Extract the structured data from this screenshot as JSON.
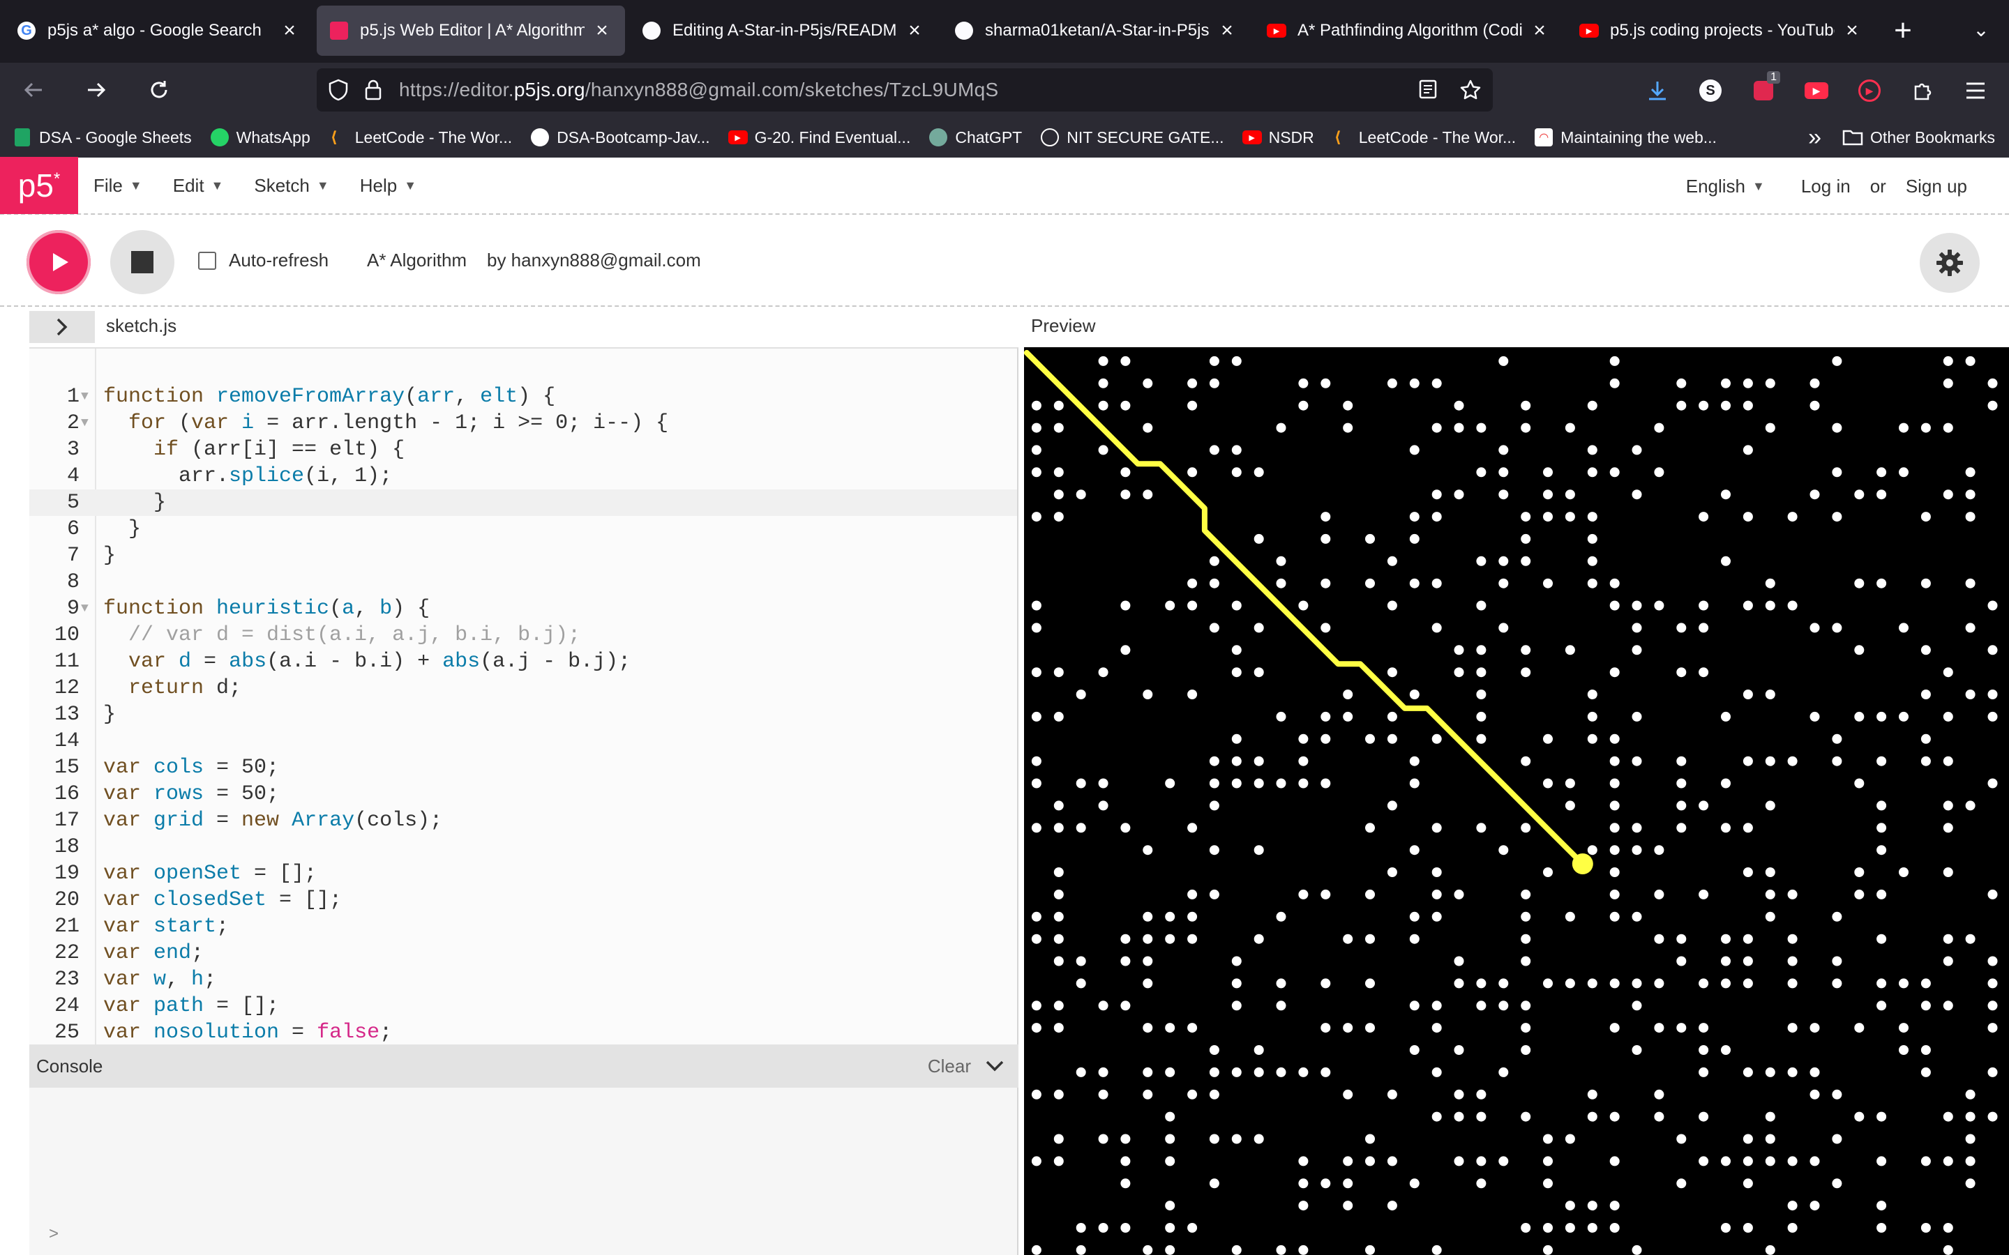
{
  "browser": {
    "tabs": [
      {
        "title": "p5js a* algo - Google Search",
        "icon": "google-icon",
        "active": false
      },
      {
        "title": "p5.js Web Editor | A* Algorithm",
        "icon": "p5-icon",
        "active": true
      },
      {
        "title": "Editing A-Star-in-P5js/README",
        "icon": "github-icon",
        "active": false
      },
      {
        "title": "sharma01ketan/A-Star-in-P5js: ",
        "icon": "github-icon",
        "active": false
      },
      {
        "title": "A* Pathfinding Algorithm (Coding",
        "icon": "youtube-icon",
        "active": false
      },
      {
        "title": "p5.js coding projects - YouTube",
        "icon": "youtube-icon",
        "active": false
      }
    ],
    "url_prefix": "https://editor.",
    "url_domain": "p5js.org",
    "url_path": "/hanxyn888@gmail.com/sketches/TzcL9UMqS",
    "extension_badge": "1",
    "profile_letter": "S",
    "bookmarks": [
      {
        "label": "DSA - Google Sheets",
        "icon": "sheets-icon",
        "color": "#1fa463"
      },
      {
        "label": "WhatsApp",
        "icon": "whatsapp-icon",
        "color": "#25d366"
      },
      {
        "label": "LeetCode - The Wor...",
        "icon": "leetcode-icon",
        "color": "#f89f1b"
      },
      {
        "label": "DSA-Bootcamp-Jav...",
        "icon": "github-icon",
        "color": "#ffffff"
      },
      {
        "label": "G-20. Find Eventual...",
        "icon": "youtube-icon",
        "color": "#ff0000"
      },
      {
        "label": "ChatGPT",
        "icon": "chatgpt-icon",
        "color": "#74aa9c"
      },
      {
        "label": "NIT SECURE GATE...",
        "icon": "globe-icon",
        "color": "#ffffff"
      },
      {
        "label": "NSDR",
        "icon": "youtube-icon",
        "color": "#ff0000"
      },
      {
        "label": "LeetCode - The Wor...",
        "icon": "leetcode-icon",
        "color": "#f89f1b"
      },
      {
        "label": "Maintaining the web...",
        "icon": "rainbow-icon",
        "color": "#ffffff"
      }
    ],
    "other_bookmarks": "Other Bookmarks"
  },
  "p5": {
    "logo": "p5",
    "menu": [
      {
        "label": "File"
      },
      {
        "label": "Edit"
      },
      {
        "label": "Sketch"
      },
      {
        "label": "Help"
      }
    ],
    "language": "English",
    "login": "Log in",
    "or": "or",
    "signup": "Sign up",
    "auto_refresh": "Auto-refresh",
    "sketch_name": "A* Algorithm",
    "sketch_owner": "by hanxyn888@gmail.com",
    "file_tab": "sketch.js",
    "preview_label": "Preview",
    "console_label": "Console",
    "console_clear": "Clear",
    "accent": "#ed225d",
    "current_line": 5
  },
  "code": [
    {
      "n": "1",
      "fold": true,
      "tokens": [
        [
          "kw",
          "function "
        ],
        [
          "fn",
          "removeFromArray"
        ],
        [
          "sp",
          "("
        ],
        [
          "vr",
          "arr"
        ],
        [
          "sp",
          ", "
        ],
        [
          "vr",
          "elt"
        ],
        [
          "sp",
          ") {"
        ]
      ]
    },
    {
      "n": "2",
      "fold": true,
      "tokens": [
        [
          "sp",
          "  "
        ],
        [
          "kw",
          "for"
        ],
        [
          "sp",
          " ("
        ],
        [
          "kw",
          "var "
        ],
        [
          "vr",
          "i"
        ],
        [
          "sp",
          " = arr.length - 1; i >= 0; i--) {"
        ]
      ]
    },
    {
      "n": "3",
      "fold": false,
      "tokens": [
        [
          "sp",
          "    "
        ],
        [
          "kw",
          "if"
        ],
        [
          "sp",
          " (arr[i] == elt) {"
        ]
      ]
    },
    {
      "n": "4",
      "fold": false,
      "tokens": [
        [
          "sp",
          "      arr."
        ],
        [
          "bi",
          "splice"
        ],
        [
          "sp",
          "(i, 1);"
        ]
      ]
    },
    {
      "n": "5",
      "fold": false,
      "tokens": [
        [
          "sp",
          "    }"
        ]
      ]
    },
    {
      "n": "6",
      "fold": false,
      "tokens": [
        [
          "sp",
          "  }"
        ]
      ]
    },
    {
      "n": "7",
      "fold": false,
      "tokens": [
        [
          "sp",
          "}"
        ]
      ]
    },
    {
      "n": "8",
      "fold": false,
      "tokens": [
        [
          "sp",
          ""
        ]
      ]
    },
    {
      "n": "9",
      "fold": true,
      "tokens": [
        [
          "kw",
          "function "
        ],
        [
          "fn",
          "heuristic"
        ],
        [
          "sp",
          "("
        ],
        [
          "vr",
          "a"
        ],
        [
          "sp",
          ", "
        ],
        [
          "vr",
          "b"
        ],
        [
          "sp",
          ") {"
        ]
      ]
    },
    {
      "n": "10",
      "fold": false,
      "tokens": [
        [
          "cm",
          "  // var d = dist(a.i, a.j, b.i, b.j);"
        ]
      ]
    },
    {
      "n": "11",
      "fold": false,
      "tokens": [
        [
          "sp",
          "  "
        ],
        [
          "kw",
          "var "
        ],
        [
          "vr",
          "d"
        ],
        [
          "sp",
          " = "
        ],
        [
          "bi",
          "abs"
        ],
        [
          "sp",
          "(a.i - b.i) + "
        ],
        [
          "bi",
          "abs"
        ],
        [
          "sp",
          "(a.j - b.j);"
        ]
      ]
    },
    {
      "n": "12",
      "fold": false,
      "tokens": [
        [
          "sp",
          "  "
        ],
        [
          "kw",
          "return"
        ],
        [
          "sp",
          " d;"
        ]
      ]
    },
    {
      "n": "13",
      "fold": false,
      "tokens": [
        [
          "sp",
          "}"
        ]
      ]
    },
    {
      "n": "14",
      "fold": false,
      "tokens": [
        [
          "sp",
          ""
        ]
      ]
    },
    {
      "n": "15",
      "fold": false,
      "tokens": [
        [
          "kw",
          "var "
        ],
        [
          "vr",
          "cols"
        ],
        [
          "sp",
          " = 50;"
        ]
      ]
    },
    {
      "n": "16",
      "fold": false,
      "tokens": [
        [
          "kw",
          "var "
        ],
        [
          "vr",
          "rows"
        ],
        [
          "sp",
          " = 50;"
        ]
      ]
    },
    {
      "n": "17",
      "fold": false,
      "tokens": [
        [
          "kw",
          "var "
        ],
        [
          "vr",
          "grid"
        ],
        [
          "sp",
          " = "
        ],
        [
          "kw",
          "new "
        ],
        [
          "bi",
          "Array"
        ],
        [
          "sp",
          "(cols);"
        ]
      ]
    },
    {
      "n": "18",
      "fold": false,
      "tokens": [
        [
          "sp",
          ""
        ]
      ]
    },
    {
      "n": "19",
      "fold": false,
      "tokens": [
        [
          "kw",
          "var "
        ],
        [
          "vr",
          "openSet"
        ],
        [
          "sp",
          " = [];"
        ]
      ]
    },
    {
      "n": "20",
      "fold": false,
      "tokens": [
        [
          "kw",
          "var "
        ],
        [
          "vr",
          "closedSet"
        ],
        [
          "sp",
          " = [];"
        ]
      ]
    },
    {
      "n": "21",
      "fold": false,
      "tokens": [
        [
          "kw",
          "var "
        ],
        [
          "vr",
          "start"
        ],
        [
          "sp",
          ";"
        ]
      ]
    },
    {
      "n": "22",
      "fold": false,
      "tokens": [
        [
          "kw",
          "var "
        ],
        [
          "vr",
          "end"
        ],
        [
          "sp",
          ";"
        ]
      ]
    },
    {
      "n": "23",
      "fold": false,
      "tokens": [
        [
          "kw",
          "var "
        ],
        [
          "vr",
          "w"
        ],
        [
          "sp",
          ", "
        ],
        [
          "vr",
          "h"
        ],
        [
          "sp",
          ";"
        ]
      ]
    },
    {
      "n": "24",
      "fold": false,
      "tokens": [
        [
          "kw",
          "var "
        ],
        [
          "vr",
          "path"
        ],
        [
          "sp",
          " = [];"
        ]
      ]
    },
    {
      "n": "25",
      "fold": false,
      "tokens": [
        [
          "kw",
          "var "
        ],
        [
          "vr",
          "nosolution"
        ],
        [
          "sp",
          " = "
        ],
        [
          "pk",
          "false"
        ],
        [
          "sp",
          ";"
        ]
      ]
    }
  ],
  "sketch": {
    "cols": 50,
    "rows": 50,
    "background": "#000000",
    "wall_color": "#ffffff",
    "path_color": "#ffff44",
    "path_cells": [
      [
        0,
        0
      ],
      [
        1,
        1
      ],
      [
        2,
        2
      ],
      [
        3,
        3
      ],
      [
        4,
        4
      ],
      [
        5,
        5
      ],
      [
        6,
        5
      ],
      [
        7,
        6
      ],
      [
        8,
        7
      ],
      [
        8,
        8
      ],
      [
        9,
        9
      ],
      [
        10,
        10
      ],
      [
        11,
        11
      ],
      [
        12,
        12
      ],
      [
        13,
        13
      ],
      [
        14,
        14
      ],
      [
        15,
        14
      ],
      [
        16,
        15
      ],
      [
        17,
        16
      ],
      [
        18,
        16
      ],
      [
        19,
        17
      ],
      [
        20,
        18
      ],
      [
        21,
        19
      ],
      [
        22,
        20
      ],
      [
        23,
        21
      ],
      [
        24,
        22
      ],
      [
        25,
        23
      ]
    ],
    "end_cell": [
      25,
      23
    ]
  }
}
